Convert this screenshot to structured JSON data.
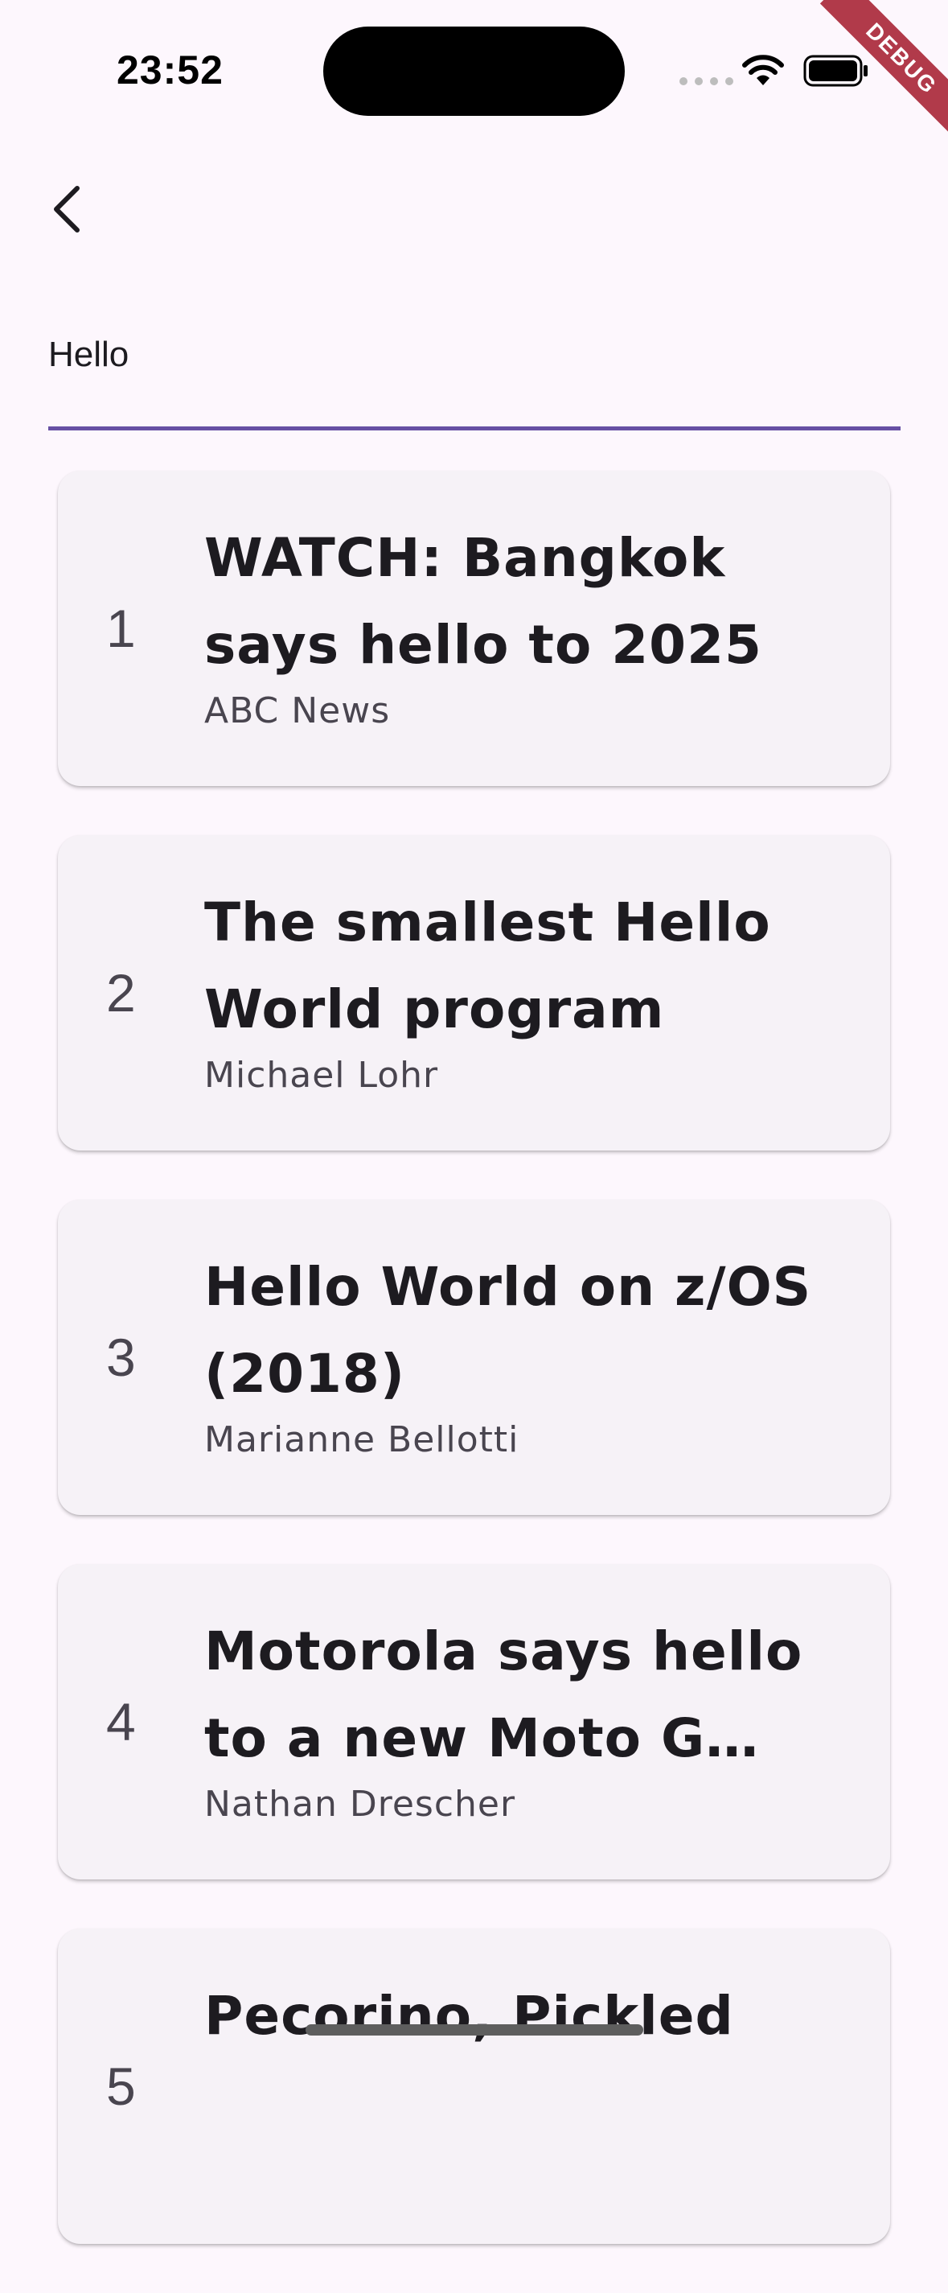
{
  "status_bar": {
    "time": "23:52"
  },
  "debug_banner": {
    "label": "DEBUG"
  },
  "search": {
    "value": "Hello",
    "accent_color": "#6750a4"
  },
  "results": [
    {
      "rank": "1",
      "title": "WATCH: Bangkok says hello to 2025",
      "author": "ABC News"
    },
    {
      "rank": "2",
      "title": "The smallest Hello World program",
      "author": "Michael Lohr"
    },
    {
      "rank": "3",
      "title": "Hello World on z/OS (2018)",
      "author": "Marianne Bellotti"
    },
    {
      "rank": "4",
      "title": "Motorola says hello to a new Moto G series",
      "author": "Nathan Drescher"
    },
    {
      "rank": "5",
      "title": "Pecorino, Pickled",
      "author": ""
    }
  ],
  "icons": {
    "back": "chevron-left-icon",
    "wifi": "wifi-icon",
    "battery": "battery-icon"
  }
}
